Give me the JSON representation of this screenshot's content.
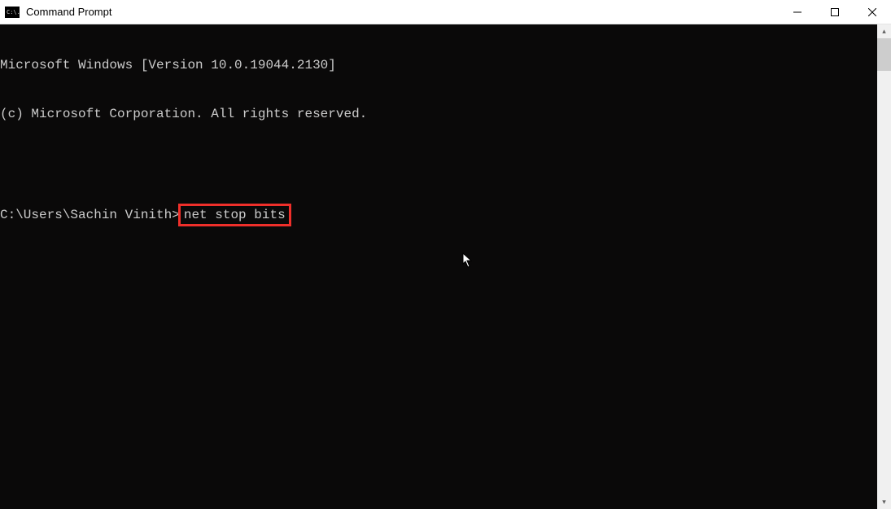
{
  "titlebar": {
    "title": "Command Prompt",
    "icon_label": "cmd-icon",
    "icon_text": "C:\\."
  },
  "window_controls": {
    "minimize": "minimize",
    "maximize": "maximize",
    "close": "close"
  },
  "terminal": {
    "line1": "Microsoft Windows [Version 10.0.19044.2130]",
    "line2": "(c) Microsoft Corporation. All rights reserved.",
    "prompt_path": "C:\\Users\\Sachin Vinith>",
    "command": "net stop bits"
  },
  "highlight": {
    "note": "command-highlight"
  },
  "scrollbar": {
    "up": "▴",
    "down": "▾"
  }
}
